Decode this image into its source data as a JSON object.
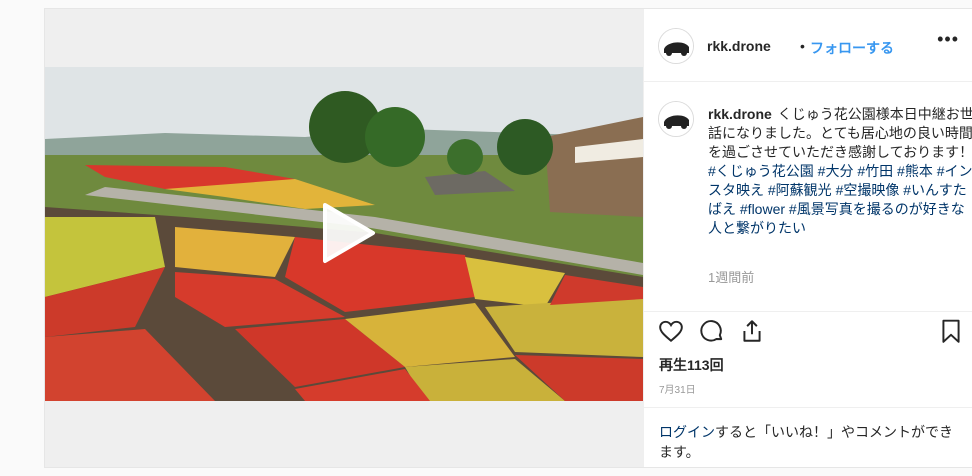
{
  "post": {
    "username": "rkk.drone",
    "separator": "•",
    "follow_label": "フォローする",
    "more_label": "•••",
    "caption_text": "くじゅう花公園様本日中継お世話になりました。とても居心地の良い時間を過ごさせていただき感謝しております！",
    "hashtags": "#くじゅう花公園 #大分 #竹田 #熊本 #インスタ映え #阿蘇観光 #空撮映像 #いんすたばえ #flower #風景写真を撮るのが好きな人と繋がりたい",
    "timestamp": "1週間前",
    "plays": "再生113回",
    "date": "7月31日",
    "login_link": "ログイン",
    "login_rest": "すると「いいね！」やコメントができます。"
  },
  "icons": {
    "play": "play-icon",
    "like": "heart-icon",
    "comment": "comment-icon",
    "share": "share-icon",
    "save": "bookmark-icon"
  }
}
